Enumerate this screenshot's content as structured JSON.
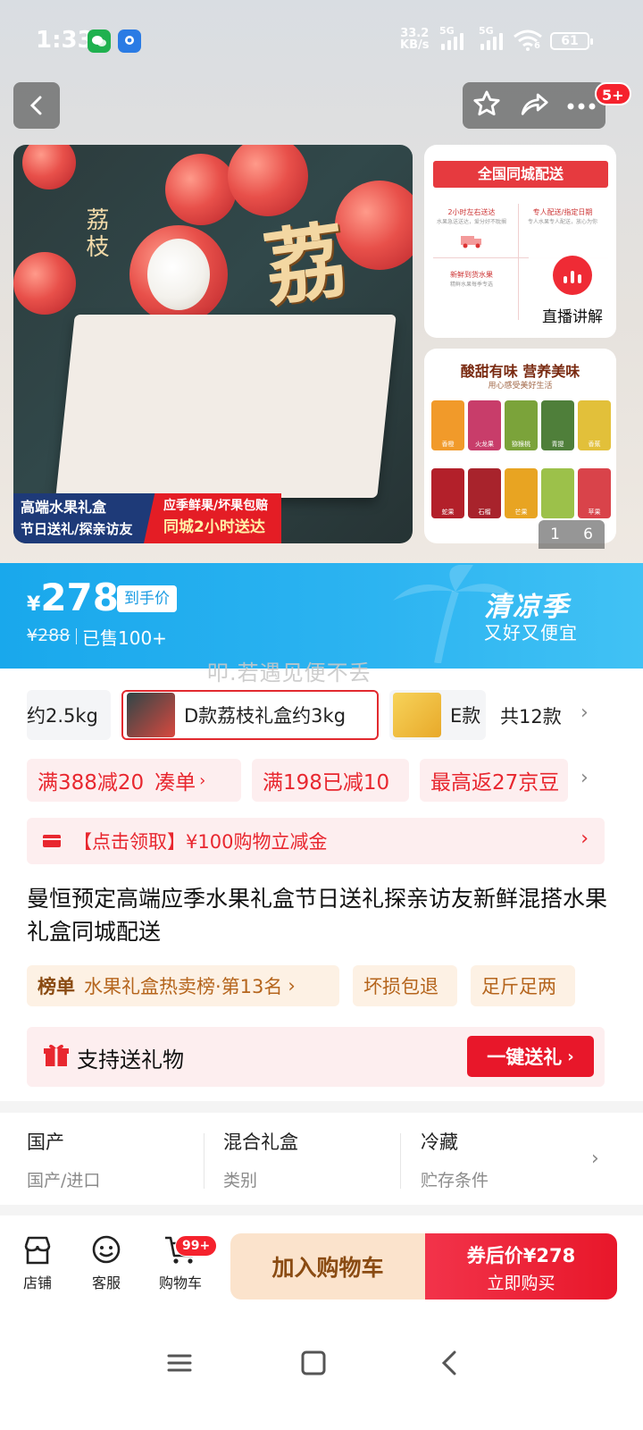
{
  "status_bar": {
    "time": "1:33",
    "net_speed_value": "33.2",
    "net_speed_unit": "KB/s",
    "sim1": "5G",
    "sim2": "5G",
    "wifi_label": "6",
    "battery": "61"
  },
  "header": {
    "badge": "5+",
    "icons": [
      "back-icon",
      "star-icon",
      "share-icon",
      "more-icon"
    ]
  },
  "gallery": {
    "main_box_label": "荔枝",
    "main_box_char": "荔",
    "ribbon": {
      "line1": "高端水果礼盒",
      "line2": "节日送礼/探亲访友",
      "line3": "应季鲜果/坏果包赔",
      "line4": "同城2小时送达"
    },
    "thumb1": {
      "heading": "全国同城配送",
      "cell1_title": "2小时左右送达",
      "cell1_sub": "水果急送送达，爱分好不耽搁",
      "cell2_title": "专人配送/指定日期",
      "cell2_sub": "专人水果专人配送，放心为你",
      "cell3_title": "新鲜到货水果",
      "cell3_sub": "精鲜水果每季专选"
    },
    "live_label": "直播讲解",
    "thumb2": {
      "title": "酸甜有味 营养美味",
      "subtitle": "用心感受美好生活",
      "fruits": [
        "香橙",
        "火龙果",
        "猕猴桃",
        "青提",
        "香蕉",
        "蛇果",
        "石榴",
        "芒果",
        "",
        "苹果"
      ]
    },
    "counter_current": "1",
    "counter_total": "6"
  },
  "price_banner": {
    "currency": "¥",
    "price": "278",
    "price_tag": "到手价",
    "original_price": "¥288",
    "sold": "已售100+",
    "season_title": "清凉季",
    "season_sub": "又好又便宜"
  },
  "watermark": "叩.若遇见便不丢",
  "skus": {
    "items": [
      "约2.5kg",
      "D款荔枝礼盒约3kg",
      "E款"
    ],
    "count": "共12款"
  },
  "promos": {
    "p1": "满388减20",
    "p1_link": "凑单",
    "p2": "满198已减10",
    "p3": "最高返27京豆"
  },
  "coupon": "【点击领取】¥100购物立减金",
  "product_title": "曼恒预定高端应季水果礼盒节日送礼探亲访友新鲜混搭水果礼盒同城配送",
  "tags": {
    "rank_label": "榜单",
    "rank_text": "水果礼盒热卖榜·第13名",
    "t2": "坏损包退",
    "t3": "足斤足两"
  },
  "gift": {
    "label": "支持送礼物",
    "button": "一键送礼"
  },
  "specs": [
    {
      "value": "国产",
      "key": "国产/进口"
    },
    {
      "value": "混合礼盒",
      "key": "类别"
    },
    {
      "value": "冷藏",
      "key": "贮存条件"
    }
  ],
  "bottom_bar": {
    "store": "店铺",
    "service": "客服",
    "cart": "购物车",
    "cart_badge": "99+",
    "add_to_cart": "加入购物车",
    "buy_line1": "券后价¥278",
    "buy_line2": "立即购买"
  },
  "colors": {
    "accent_red": "#e8172a",
    "banner_blue": "#19a8ec",
    "promo_bg": "#fdeeef",
    "tag_bg": "#fdf1e4"
  }
}
